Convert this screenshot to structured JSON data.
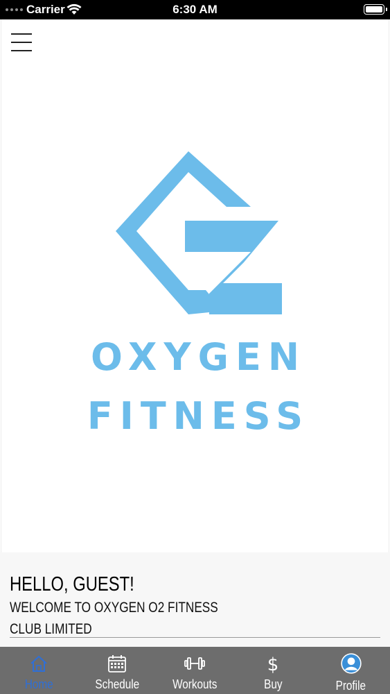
{
  "status_bar": {
    "carrier": "Carrier",
    "time": "6:30 AM"
  },
  "brand": {
    "line1": "OXYGEN",
    "line2": "FITNESS",
    "color": "#6cbcea"
  },
  "greeting": {
    "title": "HELLO, GUEST!",
    "subtitle_line1": "WELCOME TO OXYGEN O2 FITNESS",
    "subtitle_line2": "CLUB LIMITED"
  },
  "tabs": [
    {
      "label": "Home",
      "icon": "home-icon",
      "active": true
    },
    {
      "label": "Schedule",
      "icon": "calendar-icon",
      "active": false
    },
    {
      "label": "Workouts",
      "icon": "dumbbell-icon",
      "active": false
    },
    {
      "label": "Buy",
      "icon": "dollar-icon",
      "active": false
    },
    {
      "label": "Profile",
      "icon": "profile-icon",
      "active": false
    }
  ],
  "colors": {
    "tabbar_background": "#6d6d6d",
    "active_tab": "#2f6fd6",
    "profile_accent": "#3a8fd8"
  }
}
